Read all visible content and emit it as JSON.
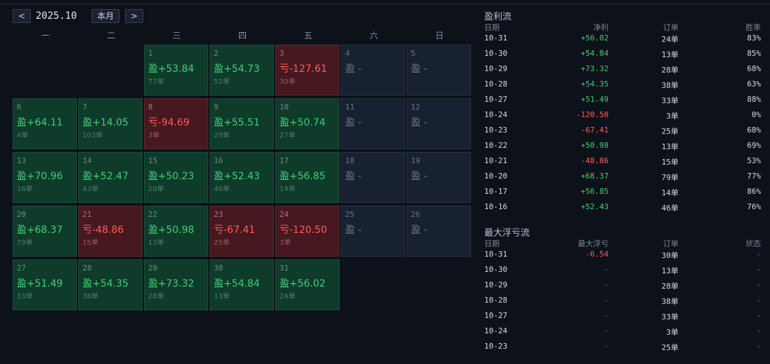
{
  "nav": {
    "prev": "<",
    "month": "2025.10",
    "today": "本月",
    "next": ">"
  },
  "weekdays": [
    "一",
    "二",
    "三",
    "四",
    "五",
    "六",
    "日"
  ],
  "calendar": [
    {
      "day": "1",
      "col": 2,
      "row": 0,
      "status": "win",
      "value": "盈+53.84",
      "orders": "77单"
    },
    {
      "day": "2",
      "col": 3,
      "row": 0,
      "status": "win",
      "value": "盈+54.73",
      "orders": "52单"
    },
    {
      "day": "3",
      "col": 4,
      "row": 0,
      "status": "loss",
      "value": "亏-127.61",
      "orders": "30单"
    },
    {
      "day": "4",
      "col": 5,
      "row": 0,
      "status": "none",
      "value": "盈 -",
      "orders": ""
    },
    {
      "day": "5",
      "col": 6,
      "row": 0,
      "status": "none",
      "value": "盈 -",
      "orders": ""
    },
    {
      "day": "6",
      "col": 0,
      "row": 1,
      "status": "win",
      "value": "盈+64.11",
      "orders": "4单"
    },
    {
      "day": "7",
      "col": 1,
      "row": 1,
      "status": "win",
      "value": "盈+14.05",
      "orders": "103单"
    },
    {
      "day": "8",
      "col": 2,
      "row": 1,
      "status": "loss",
      "value": "亏-94.69",
      "orders": "3单"
    },
    {
      "day": "9",
      "col": 3,
      "row": 1,
      "status": "win",
      "value": "盈+55.51",
      "orders": "29单"
    },
    {
      "day": "10",
      "col": 4,
      "row": 1,
      "status": "win",
      "value": "盈+50.74",
      "orders": "27单"
    },
    {
      "day": "11",
      "col": 5,
      "row": 1,
      "status": "none",
      "value": "盈 -",
      "orders": ""
    },
    {
      "day": "12",
      "col": 6,
      "row": 1,
      "status": "none",
      "value": "盈 -",
      "orders": ""
    },
    {
      "day": "13",
      "col": 0,
      "row": 2,
      "status": "win",
      "value": "盈+70.96",
      "orders": "16单"
    },
    {
      "day": "14",
      "col": 1,
      "row": 2,
      "status": "win",
      "value": "盈+52.47",
      "orders": "43单"
    },
    {
      "day": "15",
      "col": 2,
      "row": 2,
      "status": "win",
      "value": "盈+50.23",
      "orders": "20单"
    },
    {
      "day": "16",
      "col": 3,
      "row": 2,
      "status": "win",
      "value": "盈+52.43",
      "orders": "46单"
    },
    {
      "day": "17",
      "col": 4,
      "row": 2,
      "status": "win",
      "value": "盈+56.85",
      "orders": "14单"
    },
    {
      "day": "18",
      "col": 5,
      "row": 2,
      "status": "none",
      "value": "盈 -",
      "orders": ""
    },
    {
      "day": "19",
      "col": 6,
      "row": 2,
      "status": "none",
      "value": "盈 -",
      "orders": ""
    },
    {
      "day": "20",
      "col": 0,
      "row": 3,
      "status": "win",
      "value": "盈+68.37",
      "orders": "79单"
    },
    {
      "day": "21",
      "col": 1,
      "row": 3,
      "status": "loss",
      "value": "亏-48.86",
      "orders": "15单"
    },
    {
      "day": "22",
      "col": 2,
      "row": 3,
      "status": "win",
      "value": "盈+50.98",
      "orders": "13单"
    },
    {
      "day": "23",
      "col": 3,
      "row": 3,
      "status": "loss",
      "value": "亏-67.41",
      "orders": "25单"
    },
    {
      "day": "24",
      "col": 4,
      "row": 3,
      "status": "loss",
      "value": "亏-120.50",
      "orders": "3单"
    },
    {
      "day": "25",
      "col": 5,
      "row": 3,
      "status": "none",
      "value": "盈 -",
      "orders": ""
    },
    {
      "day": "26",
      "col": 6,
      "row": 3,
      "status": "none",
      "value": "盈 -",
      "orders": ""
    },
    {
      "day": "27",
      "col": 0,
      "row": 4,
      "status": "win",
      "value": "盈+51.49",
      "orders": "33单"
    },
    {
      "day": "28",
      "col": 1,
      "row": 4,
      "status": "win",
      "value": "盈+54.35",
      "orders": "38单"
    },
    {
      "day": "29",
      "col": 2,
      "row": 4,
      "status": "win",
      "value": "盈+73.32",
      "orders": "28单"
    },
    {
      "day": "30",
      "col": 3,
      "row": 4,
      "status": "win",
      "value": "盈+54.84",
      "orders": "13单"
    },
    {
      "day": "31",
      "col": 4,
      "row": 4,
      "status": "win",
      "value": "盈+56.02",
      "orders": "24单"
    }
  ],
  "profit_flow": {
    "title": "盈利流",
    "headers": [
      "日期",
      "净利",
      "订单",
      "胜率"
    ],
    "rows": [
      {
        "date": "10-31",
        "profit": "+56.02",
        "sign": "pos",
        "orders": "24单",
        "winrate": "83%"
      },
      {
        "date": "10-30",
        "profit": "+54.84",
        "sign": "pos",
        "orders": "13单",
        "winrate": "85%"
      },
      {
        "date": "10-29",
        "profit": "+73.32",
        "sign": "pos",
        "orders": "28单",
        "winrate": "68%"
      },
      {
        "date": "10-28",
        "profit": "+54.35",
        "sign": "pos",
        "orders": "38单",
        "winrate": "63%"
      },
      {
        "date": "10-27",
        "profit": "+51.49",
        "sign": "pos",
        "orders": "33单",
        "winrate": "88%"
      },
      {
        "date": "10-24",
        "profit": "-120.50",
        "sign": "neg",
        "orders": "3单",
        "winrate": "0%"
      },
      {
        "date": "10-23",
        "profit": "-67.41",
        "sign": "neg",
        "orders": "25单",
        "winrate": "68%"
      },
      {
        "date": "10-22",
        "profit": "+50.98",
        "sign": "pos",
        "orders": "13单",
        "winrate": "69%"
      },
      {
        "date": "10-21",
        "profit": "-48.86",
        "sign": "neg",
        "orders": "15单",
        "winrate": "53%"
      },
      {
        "date": "10-20",
        "profit": "+68.37",
        "sign": "pos",
        "orders": "79单",
        "winrate": "77%"
      },
      {
        "date": "10-17",
        "profit": "+56.85",
        "sign": "pos",
        "orders": "14单",
        "winrate": "86%"
      },
      {
        "date": "10-16",
        "profit": "+52.43",
        "sign": "pos",
        "orders": "46单",
        "winrate": "76%"
      }
    ]
  },
  "drawdown_flow": {
    "title": "最大浮亏流",
    "headers": [
      "日期",
      "最大浮亏",
      "订单",
      "状态"
    ],
    "rows": [
      {
        "date": "10-31",
        "value": "-6.54",
        "sign": "neg",
        "orders": "30单",
        "status": "-"
      },
      {
        "date": "10-30",
        "value": "-",
        "sign": "dim",
        "orders": "13单",
        "status": "-"
      },
      {
        "date": "10-29",
        "value": "-",
        "sign": "dim",
        "orders": "28单",
        "status": "-"
      },
      {
        "date": "10-28",
        "value": "-",
        "sign": "dim",
        "orders": "38单",
        "status": "-"
      },
      {
        "date": "10-27",
        "value": "-",
        "sign": "dim",
        "orders": "33单",
        "status": "-"
      },
      {
        "date": "10-24",
        "value": "-",
        "sign": "dim",
        "orders": "3单",
        "status": "-"
      },
      {
        "date": "10-23",
        "value": "-",
        "sign": "dim",
        "orders": "25单",
        "status": "-"
      }
    ]
  }
}
